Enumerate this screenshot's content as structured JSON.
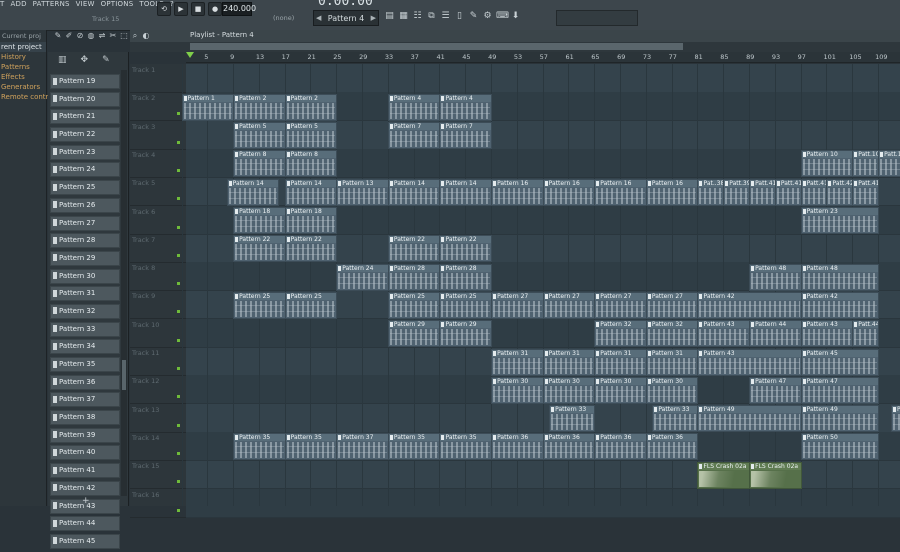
{
  "menu": [
    "T",
    "ADD",
    "PATTERNS",
    "VIEW",
    "OPTIONS",
    "TOOLS",
    "?"
  ],
  "hint": "Track 15",
  "transport": {
    "tempo": "240.000",
    "time": "0:00:00",
    "pattern": "Pattern 4",
    "snap": "(none)"
  },
  "sidebar": {
    "header": "Current proj",
    "items": [
      {
        "label": "rent project",
        "current": true
      },
      {
        "label": "History"
      },
      {
        "label": "Patterns"
      },
      {
        "label": "Effects"
      },
      {
        "label": "Generators"
      },
      {
        "label": "Remote control"
      }
    ]
  },
  "playlist": {
    "title": "Playlist - Pattern 4"
  },
  "picker": [
    "Pattern 19",
    "Pattern 20",
    "Pattern 21",
    "Pattern 22",
    "Pattern 23",
    "Pattern 24",
    "Pattern 25",
    "Pattern 26",
    "Pattern 27",
    "Pattern 28",
    "Pattern 29",
    "Pattern 30",
    "Pattern 31",
    "Pattern 32",
    "Pattern 33",
    "Pattern 34",
    "Pattern 35",
    "Pattern 36",
    "Pattern 37",
    "Pattern 38",
    "Pattern 39",
    "Pattern 40",
    "Pattern 41",
    "Pattern 42",
    "Pattern 43",
    "Pattern 44",
    "Pattern 45"
  ],
  "ruler": [
    "5",
    "9",
    "13",
    "17",
    "21",
    "25",
    "29",
    "33",
    "37",
    "41",
    "45",
    "49",
    "53",
    "57",
    "61",
    "65",
    "69",
    "73",
    "77",
    "81",
    "85",
    "89",
    "93",
    "97",
    "101",
    "105",
    "109"
  ],
  "tracks": [
    "Track 1",
    "Track 2",
    "Track 3",
    "Track 4",
    "Track 5",
    "Track 6",
    "Track 7",
    "Track 8",
    "Track 9",
    "Track 10",
    "Track 11",
    "Track 12",
    "Track 13",
    "Track 14",
    "Track 15",
    "Track 16"
  ],
  "clips": [
    {
      "t": 1,
      "b": 1,
      "l": 8,
      "n": "Pattern 1"
    },
    {
      "t": 1,
      "b": 9,
      "l": 8,
      "n": "Pattern 2"
    },
    {
      "t": 1,
      "b": 17,
      "l": 8,
      "n": "Pattern 2"
    },
    {
      "t": 1,
      "b": 33,
      "l": 8,
      "n": "Pattern 4"
    },
    {
      "t": 1,
      "b": 41,
      "l": 8,
      "n": "Pattern 4"
    },
    {
      "t": 2,
      "b": 9,
      "l": 8,
      "n": "Pattern 5"
    },
    {
      "t": 2,
      "b": 17,
      "l": 8,
      "n": "Pattern 5"
    },
    {
      "t": 2,
      "b": 33,
      "l": 8,
      "n": "Pattern 7"
    },
    {
      "t": 2,
      "b": 41,
      "l": 8,
      "n": "Pattern 7"
    },
    {
      "t": 3,
      "b": 9,
      "l": 8,
      "n": "Pattern 8"
    },
    {
      "t": 3,
      "b": 17,
      "l": 8,
      "n": "Pattern 8"
    },
    {
      "t": 3,
      "b": 97,
      "l": 8,
      "n": "Pattern 10"
    },
    {
      "t": 3,
      "b": 105,
      "l": 4,
      "n": "Patt.10"
    },
    {
      "t": 3,
      "b": 109,
      "l": 4,
      "n": "Patt.11"
    },
    {
      "t": 4,
      "b": 8,
      "l": 8,
      "n": "Pattern 14"
    },
    {
      "t": 4,
      "b": 17,
      "l": 8,
      "n": "Pattern 14"
    },
    {
      "t": 4,
      "b": 25,
      "l": 8,
      "n": "Pattern 13"
    },
    {
      "t": 4,
      "b": 33,
      "l": 8,
      "n": "Pattern 14"
    },
    {
      "t": 4,
      "b": 41,
      "l": 8,
      "n": "Pattern 14"
    },
    {
      "t": 4,
      "b": 49,
      "l": 8,
      "n": "Pattern 16"
    },
    {
      "t": 4,
      "b": 57,
      "l": 8,
      "n": "Pattern 16"
    },
    {
      "t": 4,
      "b": 65,
      "l": 8,
      "n": "Pattern 16"
    },
    {
      "t": 4,
      "b": 73,
      "l": 8,
      "n": "Pattern 16"
    },
    {
      "t": 4,
      "b": 81,
      "l": 4,
      "n": "Pat..38"
    },
    {
      "t": 4,
      "b": 85,
      "l": 4,
      "n": "Patt.39"
    },
    {
      "t": 4,
      "b": 89,
      "l": 4,
      "n": "Patt.41"
    },
    {
      "t": 4,
      "b": 93,
      "l": 4,
      "n": "Patt.41"
    },
    {
      "t": 4,
      "b": 97,
      "l": 4,
      "n": "Patt.41"
    },
    {
      "t": 4,
      "b": 101,
      "l": 4,
      "n": "Patt.42"
    },
    {
      "t": 4,
      "b": 105,
      "l": 4,
      "n": "Patt.41"
    },
    {
      "t": 5,
      "b": 9,
      "l": 8,
      "n": "Pattern 18"
    },
    {
      "t": 5,
      "b": 17,
      "l": 8,
      "n": "Pattern 18"
    },
    {
      "t": 5,
      "b": 97,
      "l": 12,
      "n": "Pattern 23"
    },
    {
      "t": 6,
      "b": 9,
      "l": 8,
      "n": "Pattern 22"
    },
    {
      "t": 6,
      "b": 17,
      "l": 8,
      "n": "Pattern 22"
    },
    {
      "t": 6,
      "b": 33,
      "l": 8,
      "n": "Pattern 22"
    },
    {
      "t": 6,
      "b": 41,
      "l": 8,
      "n": "Pattern 22"
    },
    {
      "t": 7,
      "b": 25,
      "l": 8,
      "n": "Pattern 24"
    },
    {
      "t": 7,
      "b": 33,
      "l": 8,
      "n": "Pattern 28"
    },
    {
      "t": 7,
      "b": 41,
      "l": 8,
      "n": "Pattern 28"
    },
    {
      "t": 7,
      "b": 89,
      "l": 8,
      "n": "Pattern 48"
    },
    {
      "t": 7,
      "b": 97,
      "l": 12,
      "n": "Pattern 48"
    },
    {
      "t": 8,
      "b": 9,
      "l": 8,
      "n": "Pattern 25"
    },
    {
      "t": 8,
      "b": 17,
      "l": 8,
      "n": "Pattern 25"
    },
    {
      "t": 8,
      "b": 33,
      "l": 8,
      "n": "Pattern 25"
    },
    {
      "t": 8,
      "b": 41,
      "l": 8,
      "n": "Pattern 25"
    },
    {
      "t": 8,
      "b": 49,
      "l": 8,
      "n": "Pattern 27"
    },
    {
      "t": 8,
      "b": 57,
      "l": 8,
      "n": "Pattern 27"
    },
    {
      "t": 8,
      "b": 65,
      "l": 8,
      "n": "Pattern 27"
    },
    {
      "t": 8,
      "b": 73,
      "l": 8,
      "n": "Pattern 27"
    },
    {
      "t": 8,
      "b": 81,
      "l": 16,
      "n": "Pattern 42"
    },
    {
      "t": 8,
      "b": 97,
      "l": 12,
      "n": "Pattern 42"
    },
    {
      "t": 9,
      "b": 33,
      "l": 8,
      "n": "Pattern 29"
    },
    {
      "t": 9,
      "b": 41,
      "l": 8,
      "n": "Pattern 29"
    },
    {
      "t": 9,
      "b": 65,
      "l": 8,
      "n": "Pattern 32"
    },
    {
      "t": 9,
      "b": 73,
      "l": 8,
      "n": "Pattern 32"
    },
    {
      "t": 9,
      "b": 81,
      "l": 8,
      "n": "Pattern 43"
    },
    {
      "t": 9,
      "b": 89,
      "l": 8,
      "n": "Pattern 44"
    },
    {
      "t": 9,
      "b": 97,
      "l": 8,
      "n": "Pattern 43"
    },
    {
      "t": 9,
      "b": 105,
      "l": 4,
      "n": "Patt.44"
    },
    {
      "t": 10,
      "b": 49,
      "l": 8,
      "n": "Pattern 31"
    },
    {
      "t": 10,
      "b": 57,
      "l": 8,
      "n": "Pattern 31"
    },
    {
      "t": 10,
      "b": 65,
      "l": 8,
      "n": "Pattern 31"
    },
    {
      "t": 10,
      "b": 73,
      "l": 8,
      "n": "Pattern 31"
    },
    {
      "t": 10,
      "b": 81,
      "l": 16,
      "n": "Pattern 43"
    },
    {
      "t": 10,
      "b": 97,
      "l": 12,
      "n": "Pattern 45"
    },
    {
      "t": 11,
      "b": 49,
      "l": 8,
      "n": "Pattern 30"
    },
    {
      "t": 11,
      "b": 57,
      "l": 8,
      "n": "Pattern 30"
    },
    {
      "t": 11,
      "b": 65,
      "l": 8,
      "n": "Pattern 30"
    },
    {
      "t": 11,
      "b": 73,
      "l": 8,
      "n": "Pattern 30"
    },
    {
      "t": 11,
      "b": 89,
      "l": 8,
      "n": "Pattern 47"
    },
    {
      "t": 11,
      "b": 97,
      "l": 12,
      "n": "Pattern 47"
    },
    {
      "t": 12,
      "b": 58,
      "l": 7,
      "n": "Pattern 33"
    },
    {
      "t": 12,
      "b": 74,
      "l": 7,
      "n": "Pattern 33"
    },
    {
      "t": 12,
      "b": 81,
      "l": 16,
      "n": "Pattern 49"
    },
    {
      "t": 12,
      "b": 97,
      "l": 12,
      "n": "Pattern 49"
    },
    {
      "t": 12,
      "b": 111,
      "l": 4,
      "n": "Pattern"
    },
    {
      "t": 13,
      "b": 9,
      "l": 8,
      "n": "Pattern 35"
    },
    {
      "t": 13,
      "b": 17,
      "l": 8,
      "n": "Pattern 35"
    },
    {
      "t": 13,
      "b": 25,
      "l": 8,
      "n": "Pattern 37"
    },
    {
      "t": 13,
      "b": 33,
      "l": 8,
      "n": "Pattern 35"
    },
    {
      "t": 13,
      "b": 41,
      "l": 8,
      "n": "Pattern 35"
    },
    {
      "t": 13,
      "b": 49,
      "l": 8,
      "n": "Pattern 36"
    },
    {
      "t": 13,
      "b": 57,
      "l": 8,
      "n": "Pattern 36"
    },
    {
      "t": 13,
      "b": 65,
      "l": 8,
      "n": "Pattern 36"
    },
    {
      "t": 13,
      "b": 73,
      "l": 8,
      "n": "Pattern 36"
    },
    {
      "t": 13,
      "b": 97,
      "l": 12,
      "n": "Pattern 50"
    },
    {
      "t": 14,
      "b": 81,
      "l": 8,
      "n": "FLS Crash 02a",
      "audio": true
    },
    {
      "t": 14,
      "b": 89,
      "l": 8,
      "n": "FLS Crash 02a",
      "audio": true
    }
  ]
}
